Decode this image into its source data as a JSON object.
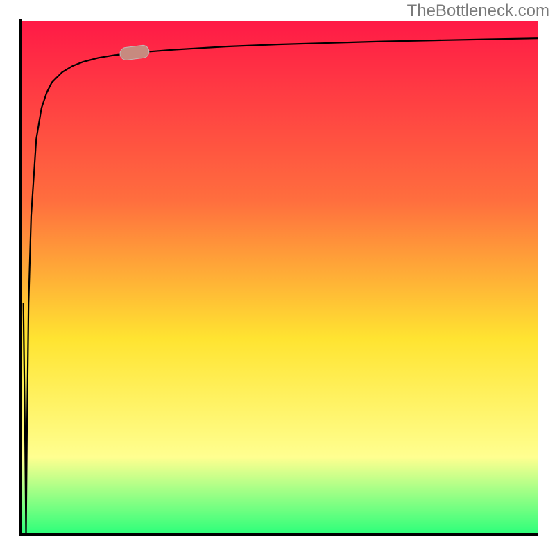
{
  "watermark": "TheBottleneck.com",
  "colors": {
    "axis": "#000000",
    "highlight_fill": "#c78a7f",
    "highlight_stroke": "#c3b8b6",
    "grad_top": "#ff1a46",
    "grad_mid1": "#ff6e3e",
    "grad_mid2": "#ffe431",
    "grad_mid3": "#ffff90",
    "grad_bottom": "#2cff7a"
  },
  "chart_data": {
    "type": "line",
    "title": "",
    "xlabel": "",
    "ylabel": "",
    "xlim": [
      0,
      100
    ],
    "ylim": [
      0,
      100
    ],
    "x": [
      0.5,
      0.8,
      1.0,
      1.2,
      1.5,
      2,
      3,
      4,
      5,
      6,
      8,
      10,
      12,
      15,
      18,
      22,
      26,
      30,
      35,
      40,
      50,
      60,
      70,
      80,
      90,
      100
    ],
    "values": [
      45,
      20,
      0,
      20,
      45,
      62,
      77,
      83,
      86,
      88,
      90,
      91.2,
      92,
      92.8,
      93.3,
      93.8,
      94.1,
      94.4,
      94.7,
      95,
      95.4,
      95.7,
      96,
      96.2,
      96.4,
      96.6
    ],
    "highlight_point": {
      "x": 22,
      "y": 93.8
    },
    "grid": false,
    "legend": false
  }
}
